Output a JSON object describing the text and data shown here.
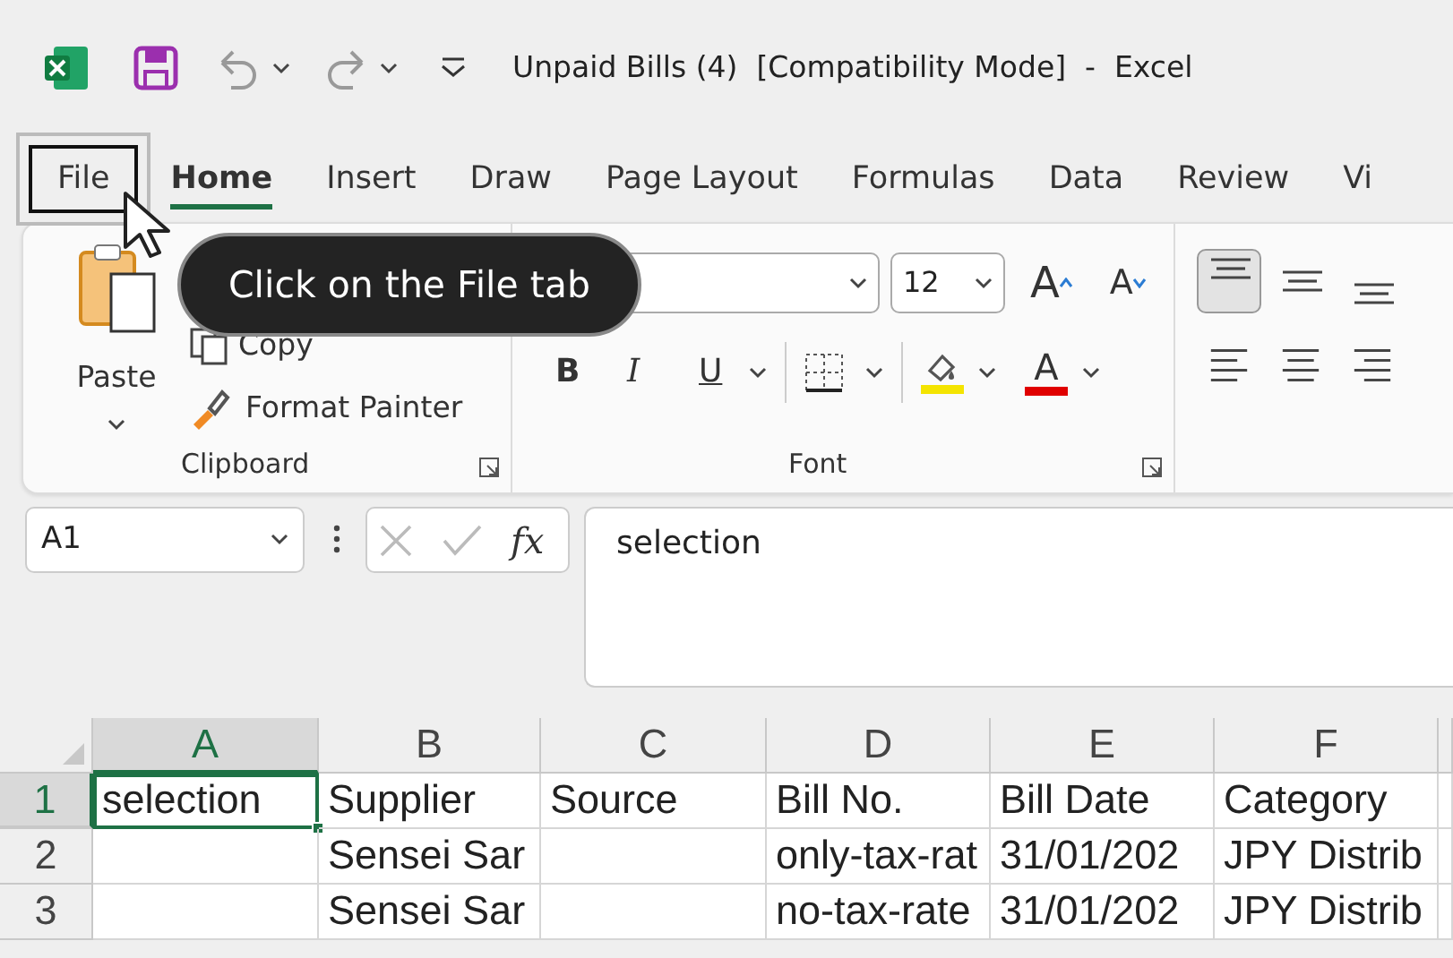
{
  "title_bar": {
    "title": "Unpaid Bills (4)  [Compatibility Mode]  -  Excel"
  },
  "tabs": [
    {
      "label": "File",
      "selected": false,
      "highlighted": true
    },
    {
      "label": "Home",
      "selected": true,
      "highlighted": false
    },
    {
      "label": "Insert",
      "selected": false,
      "highlighted": false
    },
    {
      "label": "Draw",
      "selected": false,
      "highlighted": false
    },
    {
      "label": "Page Layout",
      "selected": false,
      "highlighted": false
    },
    {
      "label": "Formulas",
      "selected": false,
      "highlighted": false
    },
    {
      "label": "Data",
      "selected": false,
      "highlighted": false
    },
    {
      "label": "Review",
      "selected": false,
      "highlighted": false
    },
    {
      "label": "Vi",
      "selected": false,
      "highlighted": false
    }
  ],
  "tooltip": {
    "text": "Click on the File tab"
  },
  "clipboard": {
    "label": "Clipboard",
    "paste": "Paste",
    "copy": "Copy",
    "format_painter": "Format Painter"
  },
  "font": {
    "label": "Font",
    "font_size": "12",
    "grow": "A",
    "shrink": "A",
    "bold": "B",
    "italic": "I",
    "underline": "U",
    "font_color": "A"
  },
  "alignment": {
    "vertical": [
      {
        "kind": "top",
        "selected": true
      },
      {
        "kind": "middle",
        "selected": false
      },
      {
        "kind": "bottom",
        "selected": false
      }
    ],
    "horizontal": [
      {
        "kind": "left",
        "selected": false
      },
      {
        "kind": "center",
        "selected": false
      },
      {
        "kind": "right",
        "selected": false
      }
    ]
  },
  "formula_bar": {
    "name_box": "A1",
    "function_button": "fx",
    "value": "selection"
  },
  "sheet": {
    "columns": [
      {
        "label": "A",
        "selected": true
      },
      {
        "label": "B",
        "selected": false
      },
      {
        "label": "C",
        "selected": false
      },
      {
        "label": "D",
        "selected": false
      },
      {
        "label": "E",
        "selected": false
      },
      {
        "label": "F",
        "selected": false
      }
    ],
    "rows": [
      {
        "header": "1",
        "selected": true,
        "cells": [
          {
            "text": "selection",
            "selected": true
          },
          {
            "text": "Supplier",
            "selected": false
          },
          {
            "text": "Source",
            "selected": false
          },
          {
            "text": "Bill No.",
            "selected": false
          },
          {
            "text": "Bill Date",
            "selected": false
          },
          {
            "text": "Category",
            "selected": false
          }
        ]
      },
      {
        "header": "2",
        "selected": false,
        "cells": [
          {
            "selected": false
          },
          {
            "text": "Sensei Sar",
            "selected": false
          },
          {
            "selected": false
          },
          {
            "text": "only-tax-rat",
            "selected": false
          },
          {
            "text": "31/01/202",
            "selected": false
          },
          {
            "text": "JPY Distrib",
            "selected": false
          }
        ]
      },
      {
        "header": "3",
        "selected": false,
        "cells": [
          {
            "selected": false
          },
          {
            "text": "Sensei Sar",
            "selected": false
          },
          {
            "selected": false
          },
          {
            "text": "no-tax-rate",
            "selected": false
          },
          {
            "text": "31/01/202",
            "selected": false
          },
          {
            "text": "JPY Distrib",
            "selected": false
          }
        ]
      }
    ]
  }
}
